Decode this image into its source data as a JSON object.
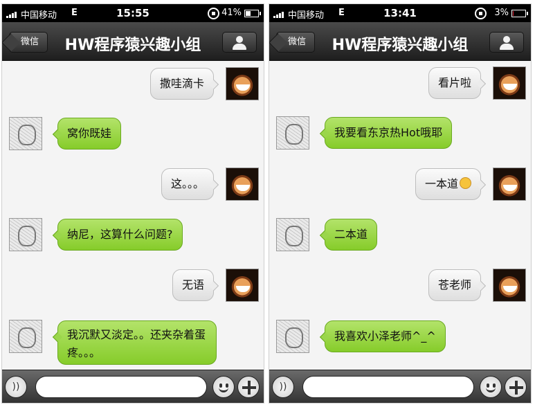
{
  "phones": [
    {
      "status": {
        "carrier": "中国移动",
        "network": "E",
        "time": "15:55",
        "battery": "41%",
        "battery_level": 0.41
      },
      "nav": {
        "back_label": "微信",
        "title": "HW程序猿兴趣小组"
      },
      "messages": [
        {
          "side": "right",
          "text": "撒哇滴卡"
        },
        {
          "side": "left",
          "text": "窝你既娃"
        },
        {
          "side": "right",
          "text": "这。。。"
        },
        {
          "side": "left",
          "text": "纳尼，这算什么问题?"
        },
        {
          "side": "right",
          "text": "无语"
        },
        {
          "side": "left",
          "text": "我沉默又淡定。。还夹杂着蛋疼。。。"
        }
      ]
    },
    {
      "status": {
        "carrier": "中国移动",
        "network": "E",
        "time": "13:41",
        "battery": "3%",
        "battery_level": 0.03
      },
      "nav": {
        "back_label": "微信",
        "title": "HW程序猿兴趣小组"
      },
      "messages": [
        {
          "side": "right",
          "text": "看片啦"
        },
        {
          "side": "left",
          "text": "我要看东京热Hot哦耶"
        },
        {
          "side": "right",
          "text": "一本道",
          "emoji": "shocked-face"
        },
        {
          "side": "left",
          "text": "二本道"
        },
        {
          "side": "right",
          "text": "苍老师"
        },
        {
          "side": "left",
          "text": "我喜欢小泽老师^_^"
        }
      ]
    }
  ],
  "icons": {
    "voice": "microphone-icon",
    "emoji": "smiley-icon",
    "plus": "plus-icon",
    "profile": "person-icon"
  },
  "colors": {
    "incoming_bubble": "#9ad64b",
    "outgoing_bubble": "#ececec",
    "navbar": "#2e2e2e"
  }
}
